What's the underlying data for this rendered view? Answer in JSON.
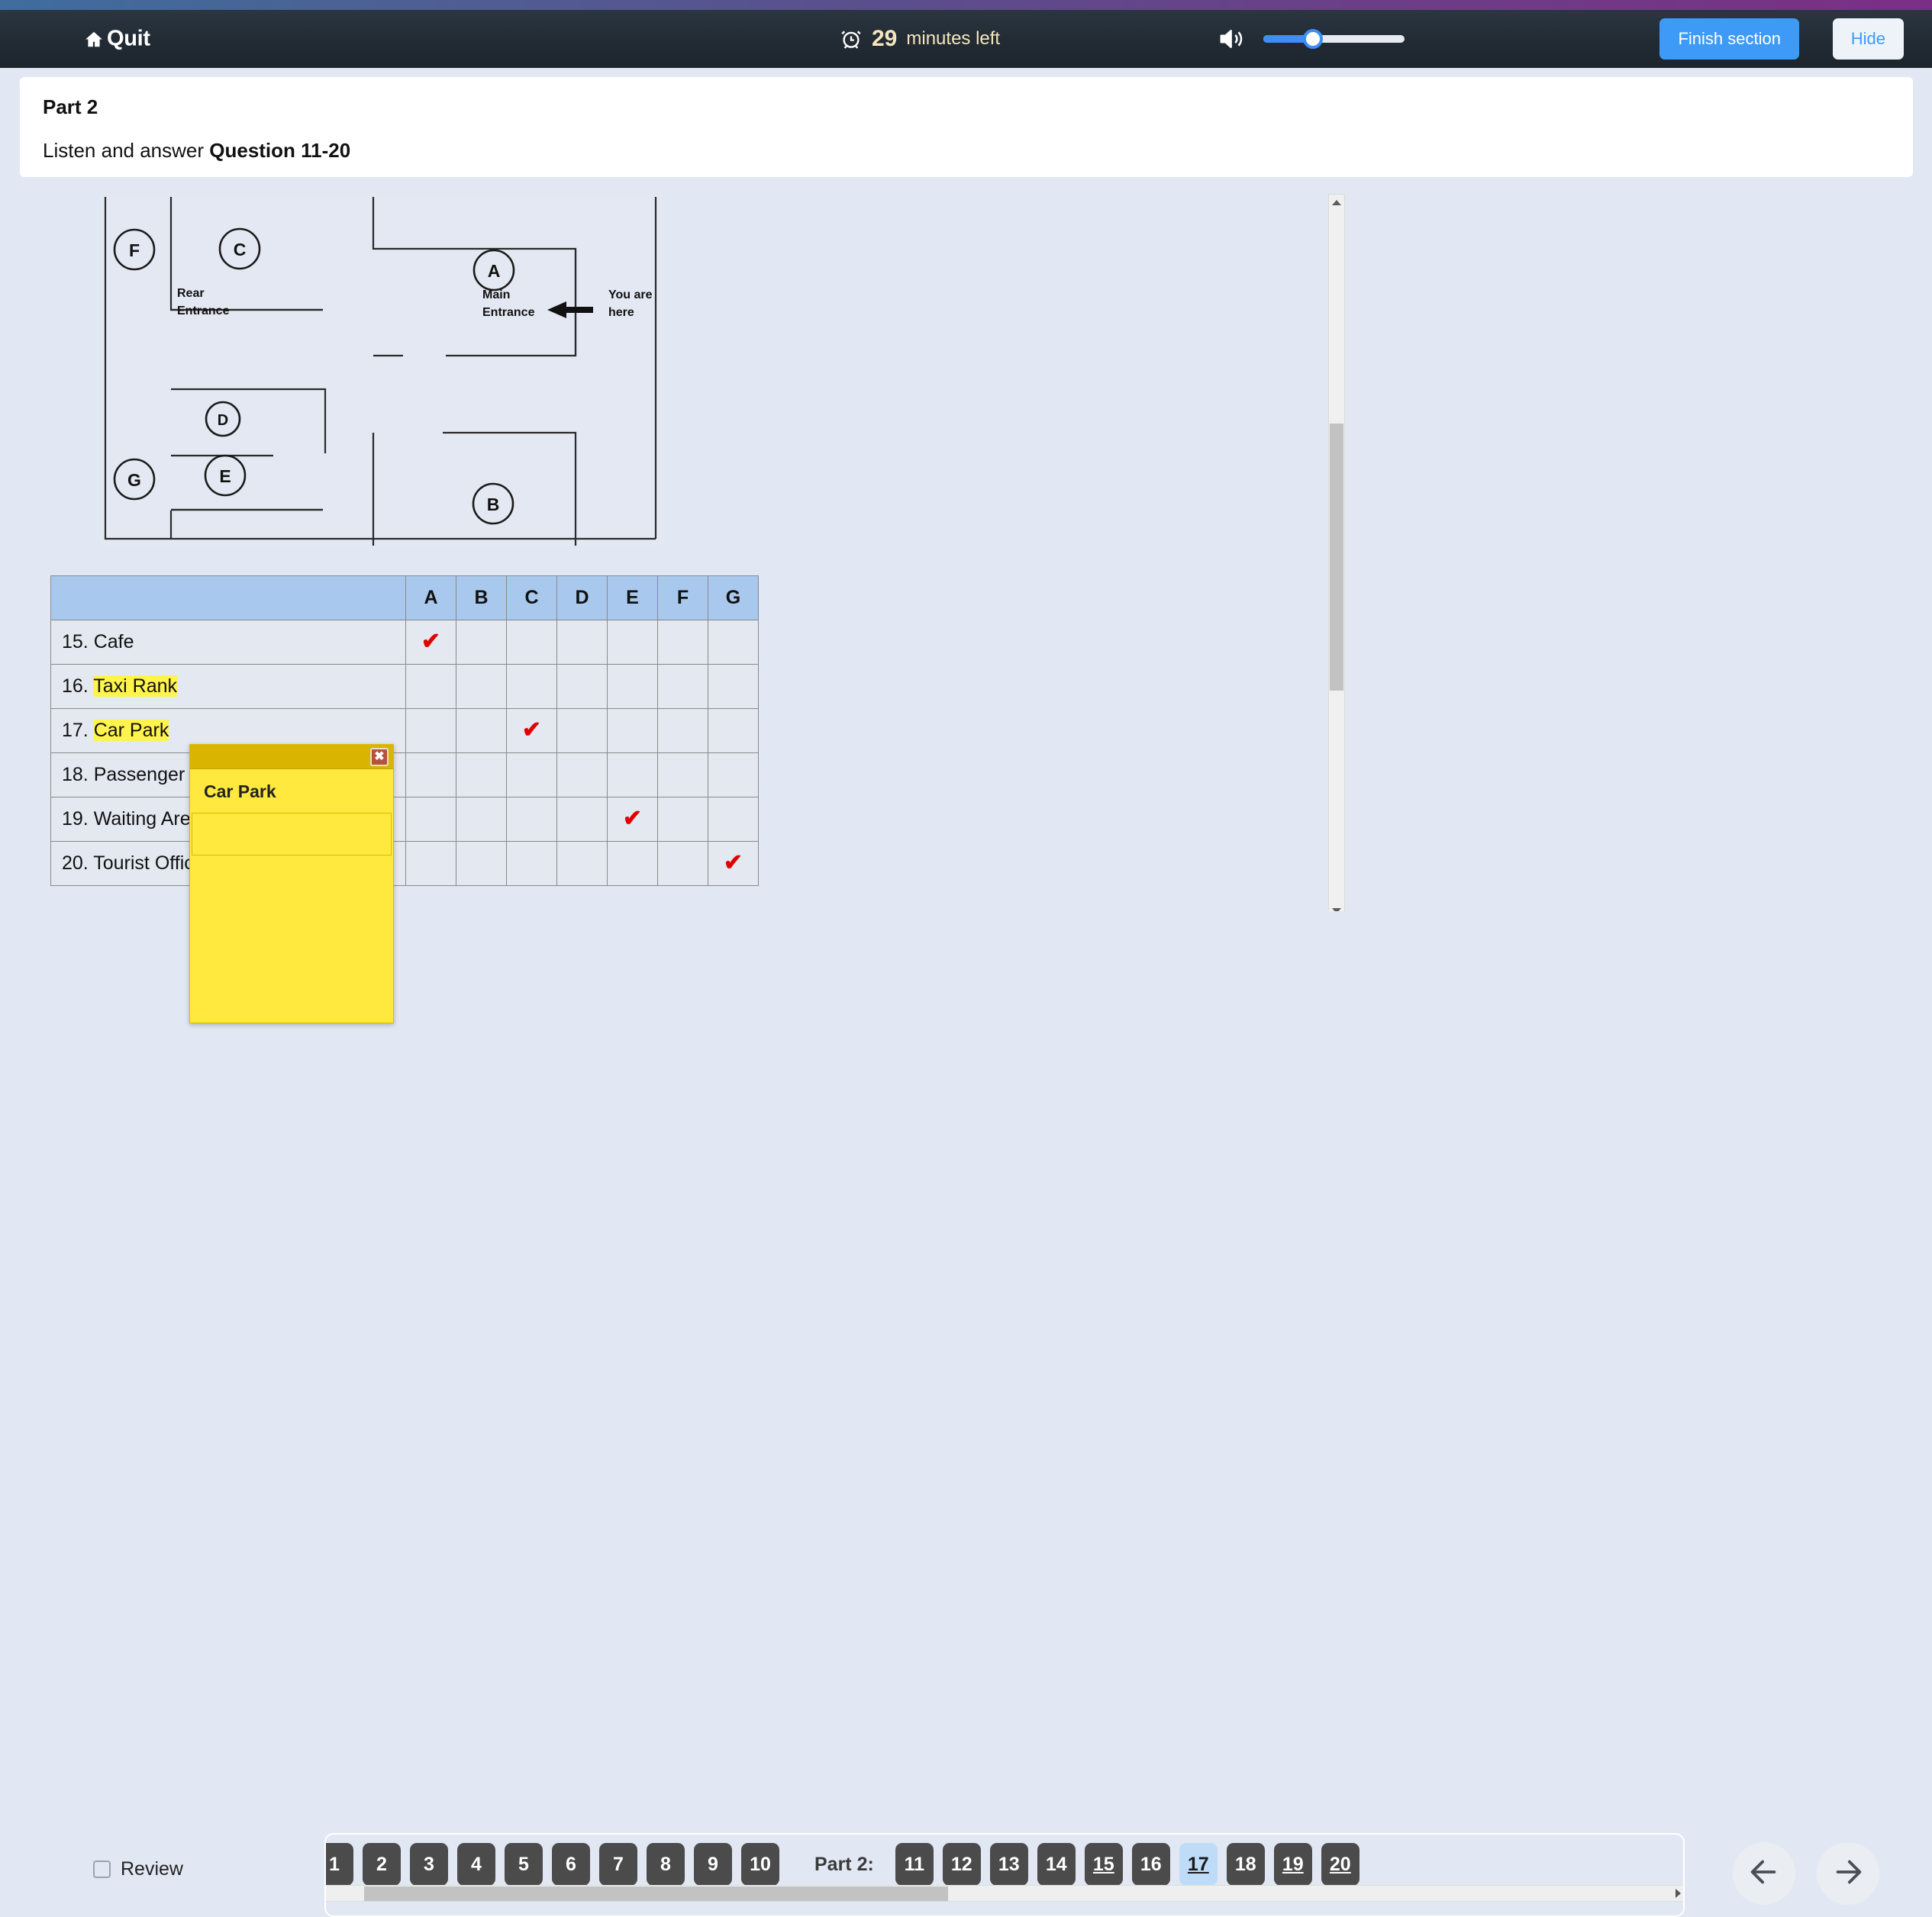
{
  "header": {
    "quit_label": "Quit",
    "timer_value": "29",
    "timer_unit": "minutes left",
    "clock_icon": "alarm-clock-icon",
    "home_icon": "home-icon",
    "speaker_icon": "speaker-icon",
    "volume_percent": 35,
    "finish_label": "Finish section",
    "hide_label": "Hide",
    "accent_blue": "#3d9bf7",
    "timer_color": "#f6e6bd"
  },
  "instructions": {
    "part": "Part 2",
    "prompt_prefix": "Listen and answer ",
    "prompt_bold": "Question 11-20"
  },
  "map": {
    "labels": {
      "rear_entrance": "Rear\nEntrance",
      "rear_entrance_line1": "Rear",
      "rear_entrance_line2": "Entrance",
      "main_entrance_line1": "Main",
      "main_entrance_line2": "Entrance",
      "you_are_here_line1": "You are",
      "you_are_here_line2": "here"
    },
    "markers": [
      "F",
      "C",
      "A",
      "D",
      "B",
      "E",
      "G"
    ]
  },
  "table": {
    "columns": [
      "A",
      "B",
      "C",
      "D",
      "E",
      "F",
      "G"
    ],
    "rows": [
      {
        "number": "15.",
        "label": "Cafe",
        "highlighted": false,
        "answer": "A"
      },
      {
        "number": "16.",
        "label": "Taxi Rank",
        "highlighted": true,
        "answer": ""
      },
      {
        "number": "17.",
        "label": "Car Park",
        "highlighted": true,
        "answer": "C"
      },
      {
        "number": "18.",
        "label": "Passenger Information",
        "highlighted": false,
        "answer": ""
      },
      {
        "number": "19.",
        "label": "Waiting Area for Bus Users",
        "highlighted": false,
        "answer": "E"
      },
      {
        "number": "20.",
        "label": "Tourist Office",
        "highlighted": false,
        "answer": "G"
      }
    ]
  },
  "note": {
    "title": "Car Park",
    "input_value": "",
    "textarea_value": "",
    "close_label": "✖"
  },
  "bottom": {
    "review_label": "Review",
    "part1": {
      "label": "",
      "numbers": [
        "1",
        "2",
        "3",
        "4",
        "5",
        "6",
        "7",
        "8",
        "9",
        "10"
      ]
    },
    "part2": {
      "label": "Part 2:",
      "numbers": [
        {
          "n": "11",
          "answered": false,
          "current": false
        },
        {
          "n": "12",
          "answered": false,
          "current": false
        },
        {
          "n": "13",
          "answered": false,
          "current": false
        },
        {
          "n": "14",
          "answered": false,
          "current": false
        },
        {
          "n": "15",
          "answered": true,
          "current": false
        },
        {
          "n": "16",
          "answered": false,
          "current": false
        },
        {
          "n": "17",
          "answered": true,
          "current": true
        },
        {
          "n": "18",
          "answered": false,
          "current": false
        },
        {
          "n": "19",
          "answered": true,
          "current": false
        },
        {
          "n": "20",
          "answered": true,
          "current": false
        }
      ]
    },
    "prev_icon": "arrow-left-icon",
    "next_icon": "arrow-right-icon"
  }
}
